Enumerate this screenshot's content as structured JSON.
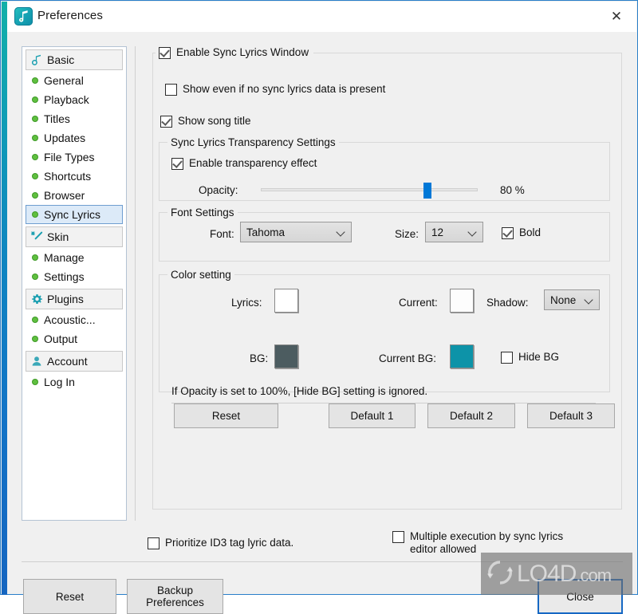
{
  "window": {
    "title": "Preferences",
    "app_icon": "music-note-icon",
    "close_label": "✕"
  },
  "sidebar": {
    "groups": [
      {
        "header": {
          "label": "Basic",
          "icon": "music-note-icon"
        },
        "items": [
          {
            "label": "General",
            "selected": false
          },
          {
            "label": "Playback",
            "selected": false
          },
          {
            "label": "Titles",
            "selected": false
          },
          {
            "label": "Updates",
            "selected": false
          },
          {
            "label": "File Types",
            "selected": false
          },
          {
            "label": "Shortcuts",
            "selected": false
          },
          {
            "label": "Browser",
            "selected": false
          },
          {
            "label": "Sync Lyrics",
            "selected": true
          }
        ]
      },
      {
        "header": {
          "label": "Skin",
          "icon": "magic-wand-icon"
        },
        "items": [
          {
            "label": "Manage",
            "selected": false
          },
          {
            "label": "Settings",
            "selected": false
          }
        ]
      },
      {
        "header": {
          "label": "Plugins",
          "icon": "gear-icon"
        },
        "items": [
          {
            "label": "Acoustic...",
            "selected": false
          },
          {
            "label": "Output",
            "selected": false
          }
        ]
      },
      {
        "header": {
          "label": "Account",
          "icon": "user-icon"
        },
        "items": [
          {
            "label": "Log In",
            "selected": false
          }
        ]
      }
    ]
  },
  "main": {
    "enable_sync_lyrics_window": {
      "label": "Enable Sync Lyrics Window",
      "checked": true
    },
    "show_even_if_no_data": {
      "label": "Show even if no sync lyrics data is present",
      "checked": false
    },
    "show_song_title": {
      "label": "Show song title",
      "checked": true
    },
    "transparency_group": {
      "legend": "Sync Lyrics Transparency Settings",
      "enable_transparency": {
        "label": "Enable transparency effect",
        "checked": true
      },
      "opacity_label": "Opacity:",
      "opacity_value": "80 %",
      "opacity_percent": 77
    },
    "font_group": {
      "legend": "Font Settings",
      "font_label": "Font:",
      "font_value": "Tahoma",
      "size_label": "Size:",
      "size_value": "12",
      "bold": {
        "label": "Bold",
        "checked": true
      }
    },
    "color_group": {
      "legend": "Color setting",
      "lyrics_label": "Lyrics:",
      "lyrics_color": "#ffffff",
      "current_label": "Current:",
      "current_color": "#fdfdfd",
      "shadow_label": "Shadow:",
      "shadow_value": "None",
      "bg_label": "BG:",
      "bg_color": "#4c5c60",
      "current_bg_label": "Current BG:",
      "current_bg_color": "#0d93a8",
      "hide_bg": {
        "label": "Hide BG",
        "checked": false
      },
      "note": "If Opacity is set to 100%, [Hide BG] setting is ignored."
    },
    "buttons": {
      "reset": "Reset",
      "default1": "Default 1",
      "default2": "Default 2",
      "default3": "Default 3"
    },
    "prioritize_id3": {
      "label": "Prioritize ID3 tag lyric data.",
      "checked": false
    },
    "multiple_execution": {
      "label": "Multiple execution by sync lyrics editor allowed",
      "checked": false
    }
  },
  "footer": {
    "reset": "Reset",
    "backup_preferences": "Backup\nPreferences",
    "backup_line1": "Backup",
    "backup_line2": "Preferences",
    "close": "Close"
  },
  "watermark": {
    "text_main": "LO4D",
    "text_suffix": ".com"
  },
  "colors": {
    "accent_blue": "#0078d7",
    "teal": "#0d93a8",
    "bullet_green": "#5fbf3f",
    "selected_bg": "#dceaf8"
  }
}
